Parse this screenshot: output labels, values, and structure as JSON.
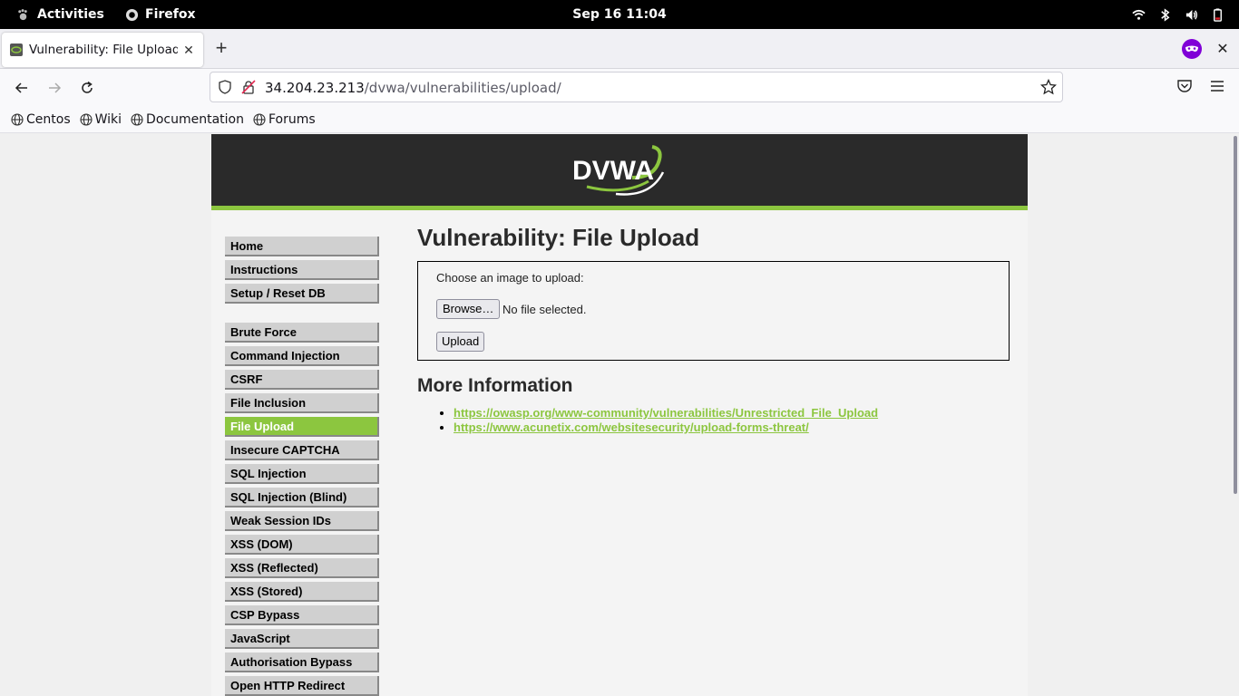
{
  "system": {
    "activities_label": "Activities",
    "app_name": "Firefox",
    "clock": "Sep 16  11:04"
  },
  "browser": {
    "tab_title": "Vulnerability: File Upload",
    "url_host": "34.204.23.213",
    "url_path": "/dvwa/vulnerabilities/upload/",
    "bookmarks": [
      "Centos",
      "Wiki",
      "Documentation",
      "Forums"
    ]
  },
  "page": {
    "logo_text": "DVWA",
    "menu_group1": [
      "Home",
      "Instructions",
      "Setup / Reset DB"
    ],
    "menu_group2": [
      "Brute Force",
      "Command Injection",
      "CSRF",
      "File Inclusion",
      "File Upload",
      "Insecure CAPTCHA",
      "SQL Injection",
      "SQL Injection (Blind)",
      "Weak Session IDs",
      "XSS (DOM)",
      "XSS (Reflected)",
      "XSS (Stored)",
      "CSP Bypass",
      "JavaScript",
      "Authorisation Bypass",
      "Open HTTP Redirect"
    ],
    "selected_menu": "File Upload",
    "title": "Vulnerability: File Upload",
    "upload_prompt": "Choose an image to upload:",
    "browse_label": "Browse…",
    "no_file_text": "No file selected.",
    "upload_label": "Upload",
    "more_info_heading": "More Information",
    "links": [
      "https://owasp.org/www-community/vulnerabilities/Unrestricted_File_Upload",
      "https://www.acunetix.com/websitesecurity/upload-forms-threat/"
    ]
  },
  "colors": {
    "accent_green": "#8cc63f",
    "header_dark": "#2a2a2a"
  }
}
